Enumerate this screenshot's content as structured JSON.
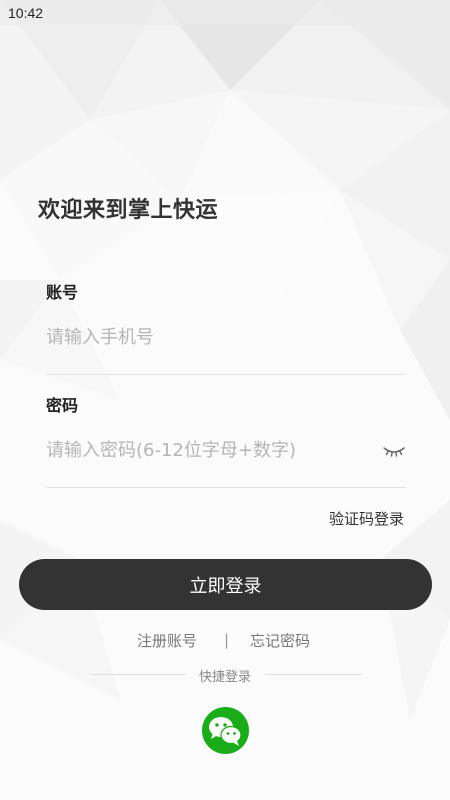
{
  "status_bar": {
    "time": "10:42"
  },
  "welcome_title": "欢迎来到掌上快运",
  "account": {
    "label": "账号",
    "placeholder": "请输入手机号"
  },
  "password": {
    "label": "密码",
    "placeholder": "请输入密码(6-12位字母+数字)",
    "toggle_icon": "eye-closed-icon"
  },
  "code_login_label": "验证码登录",
  "login_button_label": "立即登录",
  "links": {
    "register": "注册账号",
    "separator": "|",
    "forgot": "忘记密码"
  },
  "quick_login": {
    "label": "快捷登录",
    "icon": "wechat-icon"
  },
  "colors": {
    "button": "#333333",
    "wechat": "#1aad19"
  }
}
